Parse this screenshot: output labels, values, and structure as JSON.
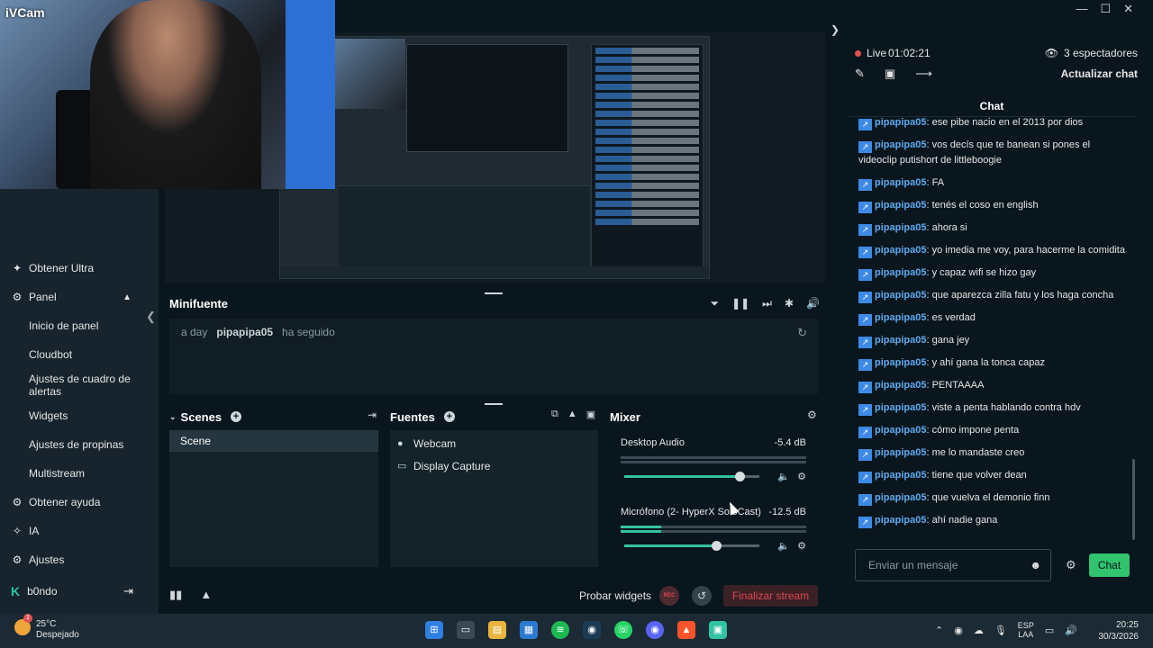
{
  "webcam": {
    "label": "iVCam"
  },
  "sidebar": {
    "items": [
      {
        "label": "Obtener Ultra",
        "icon": "ultra-icon"
      },
      {
        "label": "Panel",
        "icon": "dashboard-icon"
      },
      {
        "label": "Inicio de panel"
      },
      {
        "label": "Cloudbot"
      },
      {
        "label": "Ajustes de cuadro de alertas"
      },
      {
        "label": "Widgets"
      },
      {
        "label": "Ajustes de propinas"
      },
      {
        "label": "Multistream"
      },
      {
        "label": "Obtener ayuda",
        "icon": "help-icon"
      },
      {
        "label": "IA",
        "icon": "ai-icon"
      },
      {
        "label": "Ajustes",
        "icon": "gear-icon"
      }
    ],
    "user": {
      "name": "b0ndo"
    }
  },
  "minifuente": {
    "title": "Minifuente",
    "event": {
      "time": "a day",
      "user": "pipapipa05",
      "action": "ha seguido"
    }
  },
  "scenes": {
    "title": "Scenes",
    "items": [
      "Scene"
    ]
  },
  "sources": {
    "title": "Fuentes",
    "items": [
      "Webcam",
      "Display Capture"
    ]
  },
  "mixer": {
    "title": "Mixer",
    "channels": [
      {
        "name": "Desktop Audio",
        "db": "-5.4 dB",
        "meter": 0.0,
        "volume": 0.85
      },
      {
        "name": "Micrófono (2- HyperX SoloCast)",
        "db": "-12.5 dB",
        "meter": 0.22,
        "volume": 0.68
      }
    ]
  },
  "bottom": {
    "test_widgets": "Probar widgets",
    "rec": "REC",
    "end_stream": "Finalizar stream"
  },
  "chat": {
    "live_label": "Live",
    "live_time": "01:02:21",
    "viewers": "3 espectadores",
    "refresh": "Actualizar chat",
    "title": "Chat",
    "messages": [
      {
        "user": "pipapipa05",
        "text": "ese pibe nacio en el 2013 por dios"
      },
      {
        "user": "pipapipa05",
        "text": "vos decís que te banean si pones el videoclip putishort de littleboogie"
      },
      {
        "user": "pipapipa05",
        "text": "FA"
      },
      {
        "user": "pipapipa05",
        "text": "tenés el coso en english"
      },
      {
        "user": "pipapipa05",
        "text": "ahora si"
      },
      {
        "user": "pipapipa05",
        "text": "yo imedia me voy, para hacerme la comidita"
      },
      {
        "user": "pipapipa05",
        "text": "y capaz wifi se hizo gay"
      },
      {
        "user": "pipapipa05",
        "text": "que aparezca zilla fatu y los haga concha"
      },
      {
        "user": "pipapipa05",
        "text": "es verdad"
      },
      {
        "user": "pipapipa05",
        "text": "gana jey"
      },
      {
        "user": "pipapipa05",
        "text": "y ahí gana la tonca capaz"
      },
      {
        "user": "pipapipa05",
        "text": "PENTAAAA"
      },
      {
        "user": "pipapipa05",
        "text": "viste a penta hablando contra hdv"
      },
      {
        "user": "pipapipa05",
        "text": "cómo impone penta"
      },
      {
        "user": "pipapipa05",
        "text": "me lo mandaste creo"
      },
      {
        "user": "pipapipa05",
        "text": "tiene que volver dean"
      },
      {
        "user": "pipapipa05",
        "text": "que vuelva el demonio finn"
      },
      {
        "user": "pipapipa05",
        "text": "ahí nadie gana"
      }
    ],
    "input_placeholder": "Enviar un mensaje",
    "send": "Chat"
  },
  "taskbar": {
    "weather": {
      "temp": "25°C",
      "condition": "Despejado",
      "badge": "1"
    },
    "lang": {
      "top": "ESP",
      "bottom": "LAA"
    },
    "time": "20:25",
    "date": "30/3/2026"
  },
  "colors": {
    "accent": "#31c3a2",
    "chat_user": "#5fa9ee",
    "live": "#e05252",
    "send": "#31c36e"
  }
}
